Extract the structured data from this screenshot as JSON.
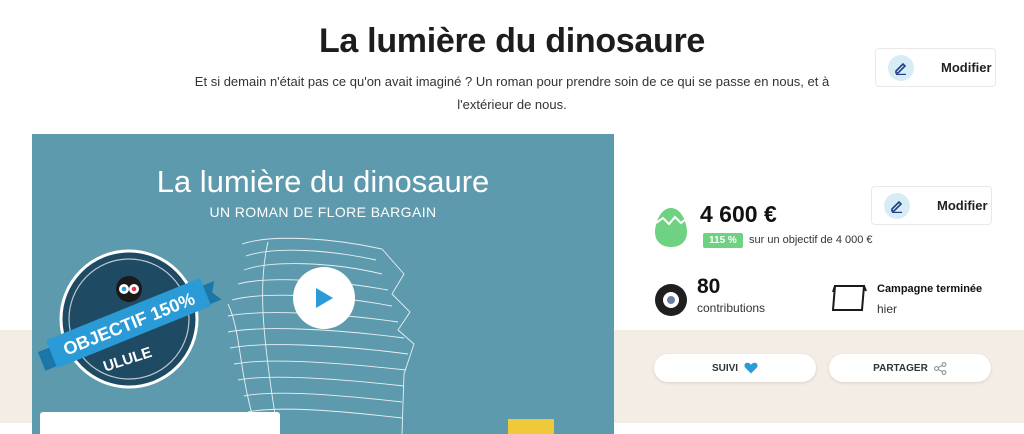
{
  "header": {
    "title": "La lumière du dinosaure",
    "subtitle": "Et si demain n'était pas ce qu'on avait imaginé ? Un roman pour prendre soin de ce qui se passe en nous, et à l'extérieur de nous.",
    "edit_label": "Modifier"
  },
  "video": {
    "title": "La lumière du dinosaure",
    "subtitle": "UN ROMAN DE FLORE BARGAIN",
    "badge_line1": "OBJECTIF 150%",
    "badge_line2": "ULULE",
    "play_icon": "play-icon"
  },
  "stats": {
    "edit_label": "Modifier",
    "amount": "4 600 €",
    "percent": "115 %",
    "goal_text": "sur un objectif de 4 000 €",
    "contributions_count": "80",
    "contributions_label": "contributions",
    "campaign_status": "Campagne terminée",
    "campaign_end": "hier"
  },
  "actions": {
    "follow_label": "SUIVI",
    "share_label": "PARTAGER"
  },
  "colors": {
    "accent_blue": "#2a9bd6",
    "success_green": "#6ed282",
    "video_bg": "#5e9aad",
    "badge_navy": "#1f4a63",
    "beige": "#f4ede6"
  }
}
